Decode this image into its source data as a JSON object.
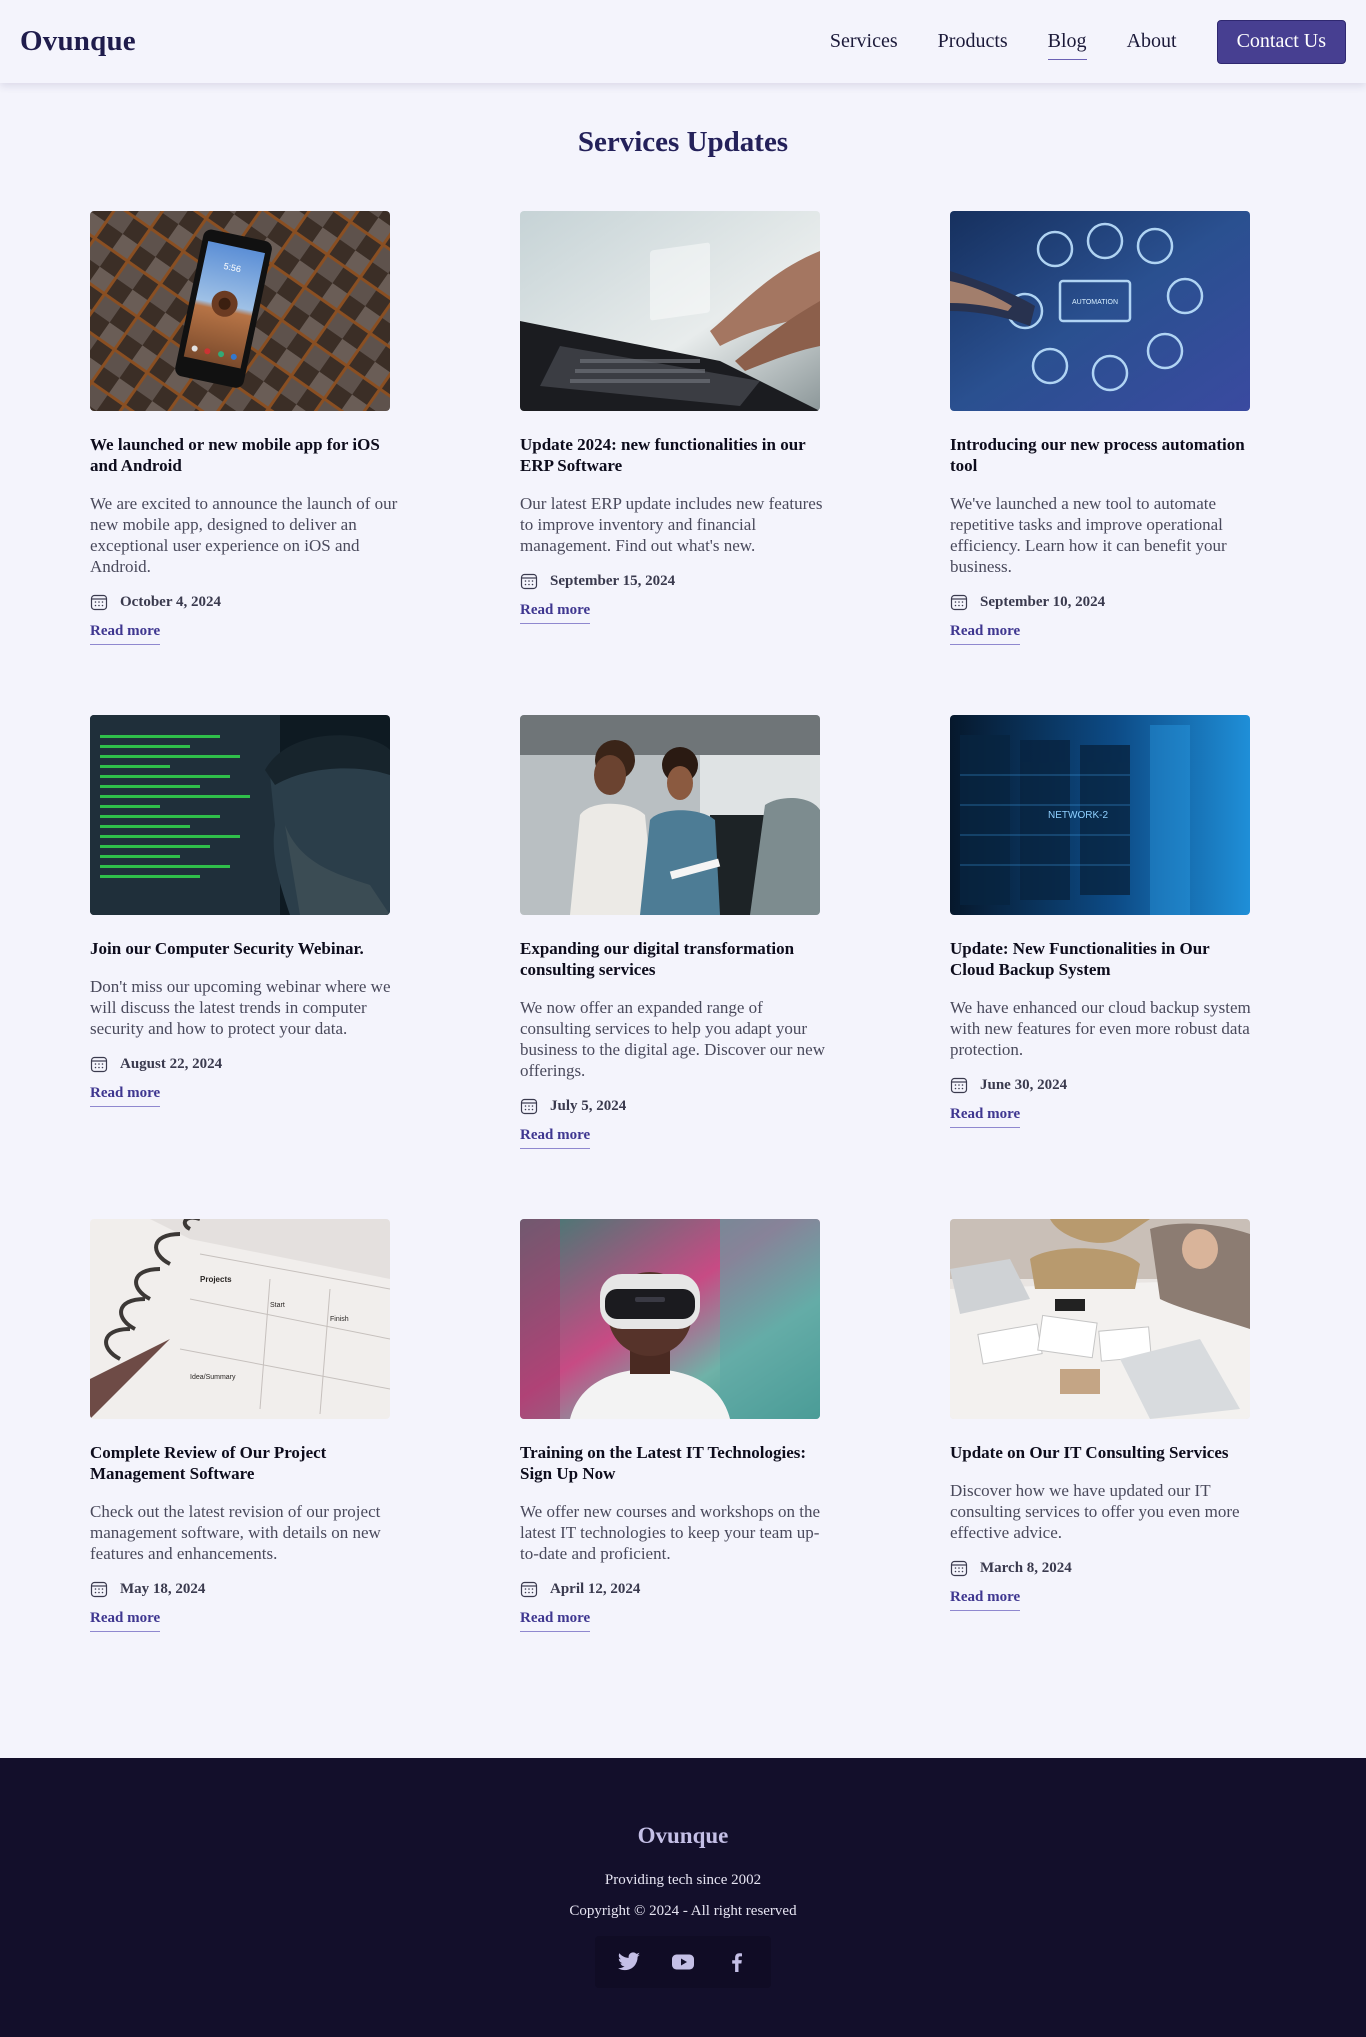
{
  "header": {
    "logo": "Ovunque",
    "nav": [
      "Services",
      "Products",
      "Blog",
      "About"
    ],
    "active_nav": "Blog",
    "contact_label": "Contact Us"
  },
  "main": {
    "title": "Services Updates",
    "read_more_label": "Read more",
    "posts": [
      {
        "title": "We launched or new mobile app for iOS and Android",
        "description": "We are excited to announce the launch of our new mobile app, designed to deliver an exceptional user experience on iOS and Android.",
        "date": "October 4, 2024",
        "image": "smartphone-on-wood-pattern"
      },
      {
        "title": "Update 2024: new functionalities in our ERP Software",
        "description": "Our latest ERP update includes new features to improve inventory and financial management. Find out what's new.",
        "date": "September 15, 2024",
        "image": "hands-typing-laptop"
      },
      {
        "title": "Introducing our new process automation tool",
        "description": "We've launched a new tool to automate repetitive tasks and improve operational efficiency. Learn how it can benefit your business.",
        "date": "September 10, 2024",
        "image": "automation-interface-icons"
      },
      {
        "title": "Join our Computer Security Webinar.",
        "description": "Don't miss our upcoming webinar where we will discuss the latest trends in computer security and how to protect your data.",
        "date": "August 22, 2024",
        "image": "man-looking-at-code-screen"
      },
      {
        "title": "Expanding our digital transformation consulting services",
        "description": "We now offer an expanded range of consulting services to help you adapt your business to the digital age. Discover our new offerings.",
        "date": "July 5, 2024",
        "image": "team-laughing-office"
      },
      {
        "title": "Update: New Functionalities in Our Cloud Backup System",
        "description": "We have enhanced our cloud backup system with new features for even more robust data protection.",
        "date": "June 30, 2024",
        "image": "server-room-blue"
      },
      {
        "title": "Complete Review of Our Project Management Software",
        "description": "Check out the latest revision of our project management software, with details on new features and enhancements.",
        "date": "May 18, 2024",
        "image": "project-planner-notebook"
      },
      {
        "title": "Training on the Latest IT Technologies: Sign Up Now",
        "description": "We offer new courses and workshops on the latest IT technologies to keep your team up-to-date and proficient.",
        "date": "April 12, 2024",
        "image": "person-vr-headset"
      },
      {
        "title": "Update on Our IT Consulting Services",
        "description": "Discover how we have updated our IT consulting services to offer you even more effective advice.",
        "date": "March 8, 2024",
        "image": "consulting-meeting-desk"
      }
    ]
  },
  "footer": {
    "logo": "Ovunque",
    "tagline": "Providing tech since 2002",
    "copyright": "Copyright © 2024 - All right reserved",
    "social": [
      "twitter-icon",
      "youtube-icon",
      "facebook-icon"
    ]
  },
  "colors": {
    "background": "#f4f4fc",
    "brand": "#473f91",
    "footer": "#130f2b",
    "link": "#3f3790"
  }
}
